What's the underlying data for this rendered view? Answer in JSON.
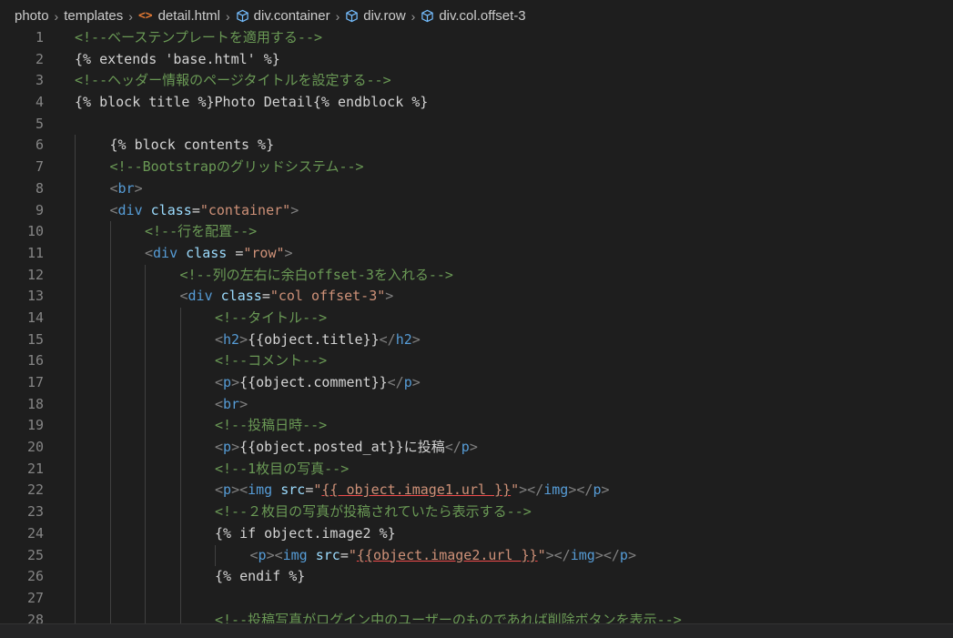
{
  "breadcrumb": {
    "items": [
      "photo",
      "templates",
      "detail.html",
      "div.container",
      "div.row",
      "div.col.offset-3"
    ]
  },
  "colors": {
    "background": "#1e1e1e",
    "comment": "#6a9955",
    "tag": "#569cd6",
    "attribute": "#9cdcfe",
    "string": "#ce9178",
    "text": "#d4d4d4",
    "line_number": "#858585",
    "html_icon": "#e37933",
    "element_icon": "#75beff"
  },
  "lines": [
    {
      "n": "1",
      "indent": 0,
      "tokens": [
        {
          "t": "comment",
          "v": "<!--ベーステンプレートを適用する-->"
        }
      ]
    },
    {
      "n": "2",
      "indent": 0,
      "tokens": [
        {
          "t": "text",
          "v": "{% extends 'base.html' %}"
        }
      ]
    },
    {
      "n": "3",
      "indent": 0,
      "tokens": [
        {
          "t": "comment",
          "v": "<!--ヘッダー情報のページタイトルを設定する-->"
        }
      ]
    },
    {
      "n": "4",
      "indent": 0,
      "tokens": [
        {
          "t": "text",
          "v": "{% block title %}Photo Detail{% endblock %}"
        }
      ]
    },
    {
      "n": "5",
      "indent": 0,
      "tokens": []
    },
    {
      "n": "6",
      "indent": 1,
      "tokens": [
        {
          "t": "text",
          "v": "{% block contents %}"
        }
      ]
    },
    {
      "n": "7",
      "indent": 1,
      "tokens": [
        {
          "t": "comment",
          "v": "<!--Bootstrapのグリッドシステム-->"
        }
      ]
    },
    {
      "n": "8",
      "indent": 1,
      "tokens": [
        {
          "t": "punct",
          "v": "<"
        },
        {
          "t": "tag",
          "v": "br"
        },
        {
          "t": "punct",
          "v": ">"
        }
      ]
    },
    {
      "n": "9",
      "indent": 1,
      "tokens": [
        {
          "t": "punct",
          "v": "<"
        },
        {
          "t": "tag",
          "v": "div"
        },
        {
          "t": "text",
          "v": " "
        },
        {
          "t": "attr",
          "v": "class"
        },
        {
          "t": "text",
          "v": "="
        },
        {
          "t": "str",
          "v": "\"container\""
        },
        {
          "t": "punct",
          "v": ">"
        }
      ]
    },
    {
      "n": "10",
      "indent": 2,
      "tokens": [
        {
          "t": "comment",
          "v": "<!--行を配置-->"
        }
      ]
    },
    {
      "n": "11",
      "indent": 2,
      "tokens": [
        {
          "t": "punct",
          "v": "<"
        },
        {
          "t": "tag",
          "v": "div"
        },
        {
          "t": "text",
          "v": " "
        },
        {
          "t": "attr",
          "v": "class"
        },
        {
          "t": "text",
          "v": " ="
        },
        {
          "t": "str",
          "v": "\"row\""
        },
        {
          "t": "punct",
          "v": ">"
        }
      ]
    },
    {
      "n": "12",
      "indent": 3,
      "tokens": [
        {
          "t": "comment",
          "v": "<!--列の左右に余白offset-3を入れる-->"
        }
      ]
    },
    {
      "n": "13",
      "indent": 3,
      "tokens": [
        {
          "t": "punct",
          "v": "<"
        },
        {
          "t": "tag",
          "v": "div"
        },
        {
          "t": "text",
          "v": " "
        },
        {
          "t": "attr",
          "v": "class"
        },
        {
          "t": "text",
          "v": "="
        },
        {
          "t": "str",
          "v": "\"col offset-3\""
        },
        {
          "t": "punct",
          "v": ">"
        }
      ]
    },
    {
      "n": "14",
      "indent": 4,
      "tokens": [
        {
          "t": "comment",
          "v": "<!--タイトル-->"
        }
      ]
    },
    {
      "n": "15",
      "indent": 4,
      "tokens": [
        {
          "t": "punct",
          "v": "<"
        },
        {
          "t": "tag",
          "v": "h2"
        },
        {
          "t": "punct",
          "v": ">"
        },
        {
          "t": "text",
          "v": "{{object.title}}"
        },
        {
          "t": "punct",
          "v": "</"
        },
        {
          "t": "tag",
          "v": "h2"
        },
        {
          "t": "punct",
          "v": ">"
        }
      ]
    },
    {
      "n": "16",
      "indent": 4,
      "tokens": [
        {
          "t": "comment",
          "v": "<!--コメント-->"
        }
      ]
    },
    {
      "n": "17",
      "indent": 4,
      "tokens": [
        {
          "t": "punct",
          "v": "<"
        },
        {
          "t": "tag",
          "v": "p"
        },
        {
          "t": "punct",
          "v": ">"
        },
        {
          "t": "text",
          "v": "{{object.comment}}"
        },
        {
          "t": "punct",
          "v": "</"
        },
        {
          "t": "tag",
          "v": "p"
        },
        {
          "t": "punct",
          "v": ">"
        }
      ]
    },
    {
      "n": "18",
      "indent": 4,
      "tokens": [
        {
          "t": "punct",
          "v": "<"
        },
        {
          "t": "tag",
          "v": "br"
        },
        {
          "t": "punct",
          "v": ">"
        }
      ]
    },
    {
      "n": "19",
      "indent": 4,
      "tokens": [
        {
          "t": "comment",
          "v": "<!--投稿日時-->"
        }
      ]
    },
    {
      "n": "20",
      "indent": 4,
      "tokens": [
        {
          "t": "punct",
          "v": "<"
        },
        {
          "t": "tag",
          "v": "p"
        },
        {
          "t": "punct",
          "v": ">"
        },
        {
          "t": "text",
          "v": "{{object.posted_at}}に投稿"
        },
        {
          "t": "punct",
          "v": "</"
        },
        {
          "t": "tag",
          "v": "p"
        },
        {
          "t": "punct",
          "v": ">"
        }
      ]
    },
    {
      "n": "21",
      "indent": 4,
      "tokens": [
        {
          "t": "comment",
          "v": "<!--1枚目の写真-->"
        }
      ]
    },
    {
      "n": "22",
      "indent": 4,
      "tokens": [
        {
          "t": "punct",
          "v": "<"
        },
        {
          "t": "tag",
          "v": "p"
        },
        {
          "t": "punct",
          "v": "><"
        },
        {
          "t": "tag",
          "v": "img"
        },
        {
          "t": "text",
          "v": " "
        },
        {
          "t": "attr",
          "v": "src"
        },
        {
          "t": "text",
          "v": "="
        },
        {
          "t": "str",
          "v": "\""
        },
        {
          "t": "strerr",
          "v": "{{ object.image1.url }}"
        },
        {
          "t": "str",
          "v": "\""
        },
        {
          "t": "punct",
          "v": "></"
        },
        {
          "t": "tag",
          "v": "img"
        },
        {
          "t": "punct",
          "v": "></"
        },
        {
          "t": "tag",
          "v": "p"
        },
        {
          "t": "punct",
          "v": ">"
        }
      ]
    },
    {
      "n": "23",
      "indent": 4,
      "tokens": [
        {
          "t": "comment",
          "v": "<!--２枚目の写真が投稿されていたら表示する-->"
        }
      ]
    },
    {
      "n": "24",
      "indent": 4,
      "tokens": [
        {
          "t": "text",
          "v": "{% if object.image2 %}"
        }
      ]
    },
    {
      "n": "25",
      "indent": 5,
      "tokens": [
        {
          "t": "punct",
          "v": "<"
        },
        {
          "t": "tag",
          "v": "p"
        },
        {
          "t": "punct",
          "v": "><"
        },
        {
          "t": "tag",
          "v": "img"
        },
        {
          "t": "text",
          "v": " "
        },
        {
          "t": "attr",
          "v": "src"
        },
        {
          "t": "text",
          "v": "="
        },
        {
          "t": "str",
          "v": "\""
        },
        {
          "t": "strerr",
          "v": "{{object.image2.url }}"
        },
        {
          "t": "str",
          "v": "\""
        },
        {
          "t": "punct",
          "v": "></"
        },
        {
          "t": "tag",
          "v": "img"
        },
        {
          "t": "punct",
          "v": "></"
        },
        {
          "t": "tag",
          "v": "p"
        },
        {
          "t": "punct",
          "v": ">"
        }
      ]
    },
    {
      "n": "26",
      "indent": 4,
      "tokens": [
        {
          "t": "text",
          "v": "{% endif %}"
        }
      ]
    },
    {
      "n": "27",
      "indent": 4,
      "tokens": []
    },
    {
      "n": "28",
      "indent": 4,
      "tokens": [
        {
          "t": "comment",
          "v": "<!--投稿写真がログイン中のユーザーのものであれば削除ボタンを表示-->"
        }
      ]
    }
  ]
}
